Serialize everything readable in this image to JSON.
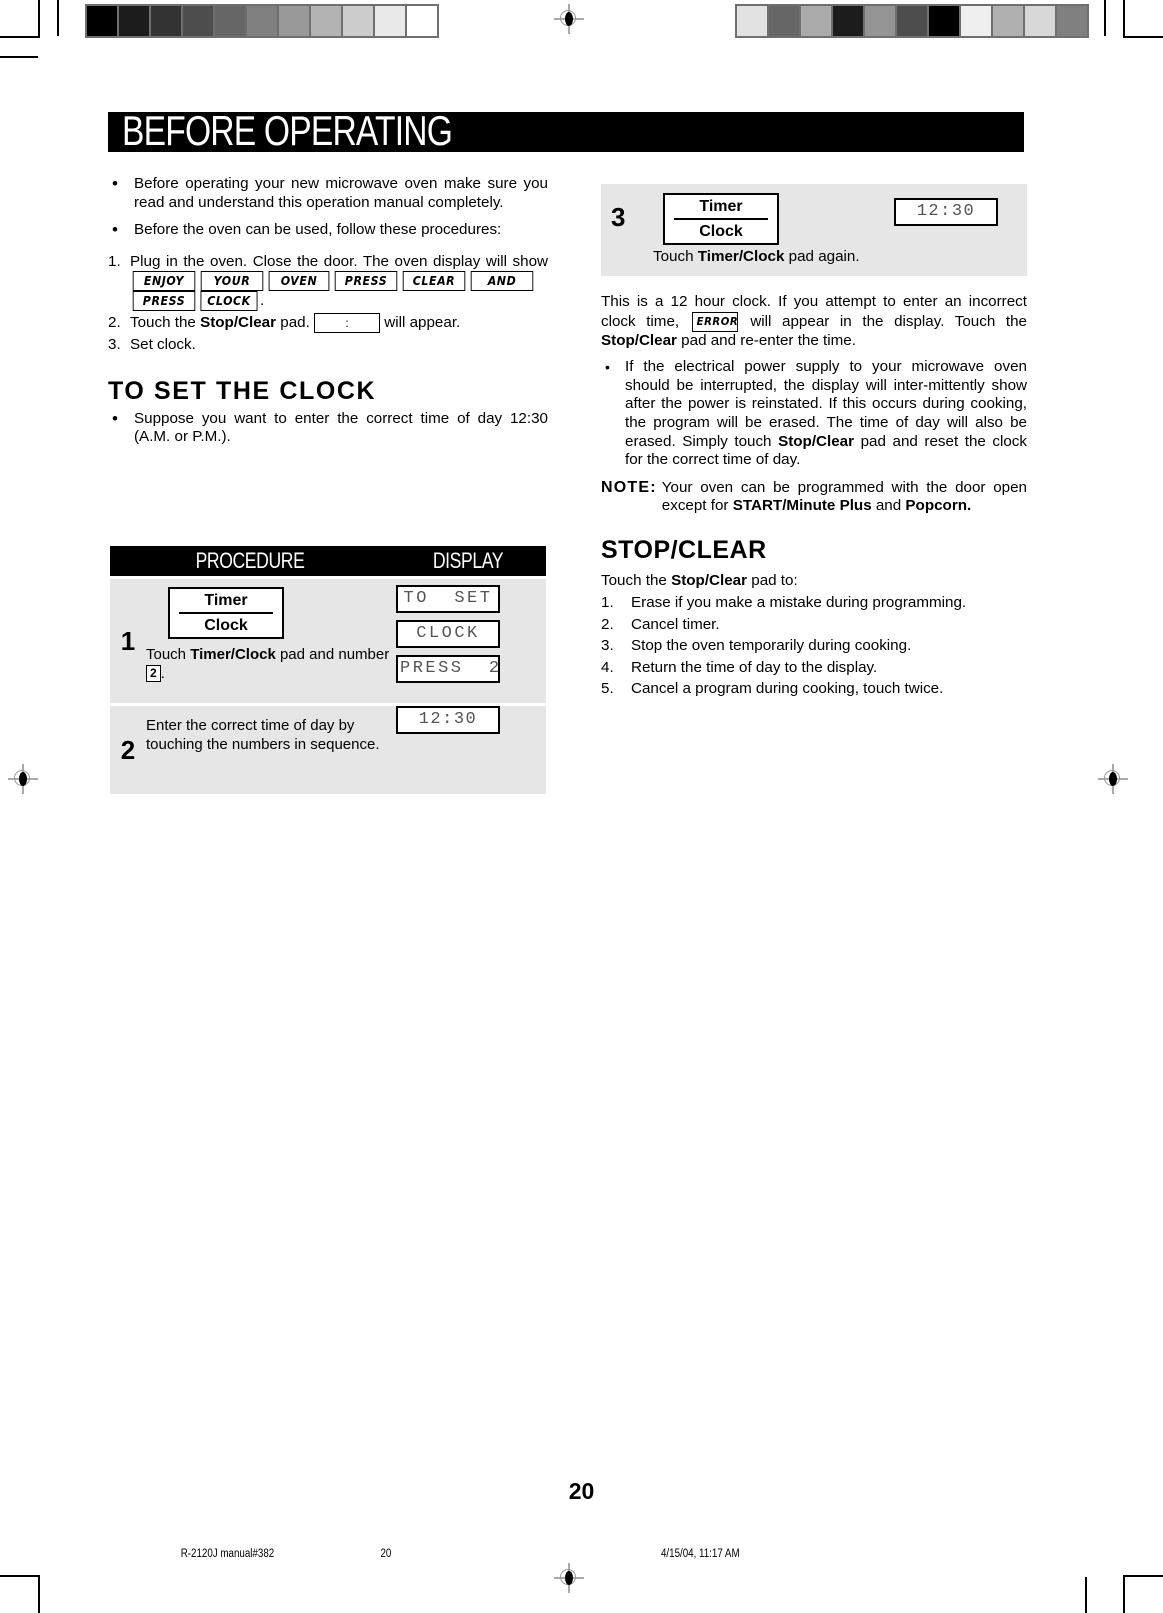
{
  "page": {
    "banner_title": "BEFORE OPERATING",
    "page_number": "20"
  },
  "intro": {
    "bullets": [
      "Before operating your new microwave oven make sure you read and understand this operation manual completely.",
      "Before the oven can be used, follow these procedures:"
    ],
    "steps": [
      {
        "num": "1.",
        "text_before": "Plug in the oven. Close the door. The oven display will show",
        "lcd_words": [
          "ENJOY",
          "YOUR",
          "OVEN",
          "PRESS",
          "CLEAR",
          "AND",
          "PRESS",
          "CLOCK"
        ],
        "text_after": "."
      },
      {
        "num": "2.",
        "text_before": "Touch the ",
        "bold": "Stop/Clear",
        "text_mid": " pad.",
        "blank_display": ":",
        "text_after": "will appear."
      },
      {
        "num": "3.",
        "text_before": "Set clock."
      }
    ]
  },
  "clock_section": {
    "heading": "TO SET THE CLOCK",
    "bullet": "Suppose you want to enter the correct time of day 12:30 (A.M. or P.M.)."
  },
  "procedure_table": {
    "header_procedure": "PROCEDURE",
    "header_display": "DISPLAY",
    "rows": [
      {
        "step": "1",
        "pad_top": "Timer",
        "pad_bottom": "Clock",
        "instruction_pre": "Touch ",
        "instruction_bold": "Timer/Clock",
        "instruction_post": " pad and number ",
        "instruction_key": "2",
        "instruction_end": ".",
        "displays": [
          "TO  SET",
          "CLOCK",
          "PRESS  2"
        ]
      },
      {
        "step": "2",
        "instruction_plain": "Enter the correct time of day by touching the numbers in sequence.",
        "displays": [
          "12:30"
        ]
      }
    ]
  },
  "step3": {
    "step": "3",
    "pad_top": "Timer",
    "pad_bottom": "Clock",
    "display": "12:30",
    "caption_pre": "Touch ",
    "caption_bold": "Timer/Clock",
    "caption_post": " pad again."
  },
  "right_column": {
    "paragraph_pre": "This is a 12 hour clock. If you attempt to enter an incorrect clock time, ",
    "error_lcd": "ERROR",
    "paragraph_mid": " will appear in the display. Touch the ",
    "paragraph_bold": "Stop/Clear",
    "paragraph_post": " pad and re-enter the time.",
    "power_bullet_1": "If the electrical power supply to your microwave oven should be interrupted, the display will inter-mittently show after the power is reinstated. If this occurs  during cooking, the program will be erased. The time of day will also be erased. Simply touch ",
    "power_bullet_bold": "Stop/Clear",
    "power_bullet_2": " pad and reset the clock for the correct time of day.",
    "note_label": "NOTE:",
    "note_text_1": " Your oven can be programmed with the door open except for ",
    "note_bold_1": "START/Minute Plus",
    "note_text_2": " and ",
    "note_bold_2": "Popcorn.",
    "stopclear_heading": "STOP/CLEAR",
    "stopclear_intro_pre": "Touch the ",
    "stopclear_intro_bold": "Stop/Clear",
    "stopclear_intro_post": " pad to:",
    "stopclear_items": [
      {
        "num": "1.",
        "text": "Erase if you make a mistake during programming."
      },
      {
        "num": "2.",
        "text": "Cancel timer."
      },
      {
        "num": "3.",
        "text": "Stop the oven temporarily during cooking."
      },
      {
        "num": "4.",
        "text": "Return the time of day to the display."
      },
      {
        "num": "5.",
        "text": "Cancel a program during cooking, touch twice."
      }
    ]
  },
  "footer": {
    "left": "R-2120J manual#382",
    "center": "20",
    "right": "4/15/04, 11:17 AM"
  },
  "calibration": {
    "left_strip": [
      "#000000",
      "#1c1c1c",
      "#333333",
      "#4d4d4d",
      "#666666",
      "#808080",
      "#999999",
      "#b3b3b3",
      "#cccccc",
      "#e8e8e8",
      "#ffffff"
    ],
    "right_strip": [
      "#e2e2e2",
      "#666666",
      "#aaaaaa",
      "#1c1c1c",
      "#949494",
      "#4d4d4d",
      "#000000",
      "#efefef",
      "#b0b0b0",
      "#d8d8d8",
      "#808080"
    ]
  }
}
